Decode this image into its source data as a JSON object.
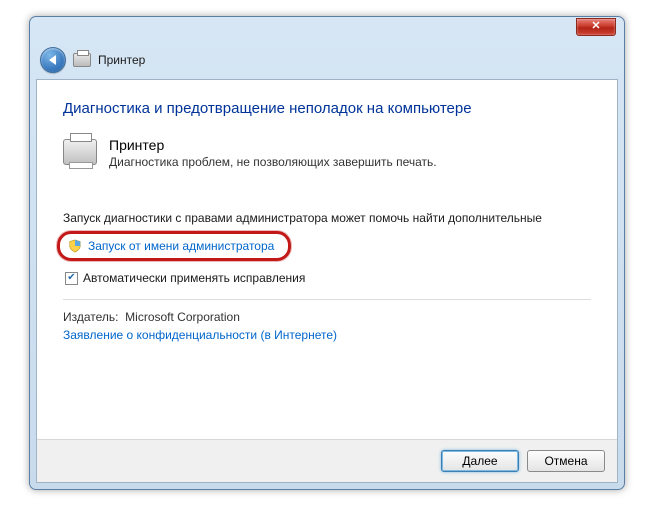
{
  "titlebar": {
    "close_glyph": "✕"
  },
  "nav": {
    "title": "Принтер"
  },
  "heading": "Диагностика и предотвращение неполадок на компьютере",
  "section": {
    "title": "Принтер",
    "desc": "Диагностика проблем, не позволяющих завершить печать."
  },
  "diag_text": "Запуск диагностики с правами администратора может помочь найти дополнительные",
  "admin_link": "Запуск от имени администратора",
  "checkbox": {
    "checked_glyph": "✔",
    "label": "Автоматически применять исправления"
  },
  "publisher": {
    "label": "Издатель:",
    "value": "Microsoft Corporation"
  },
  "privacy_link": "Заявление о конфиденциальности (в Интернете)",
  "footer": {
    "next": "Далее",
    "cancel": "Отмена"
  }
}
